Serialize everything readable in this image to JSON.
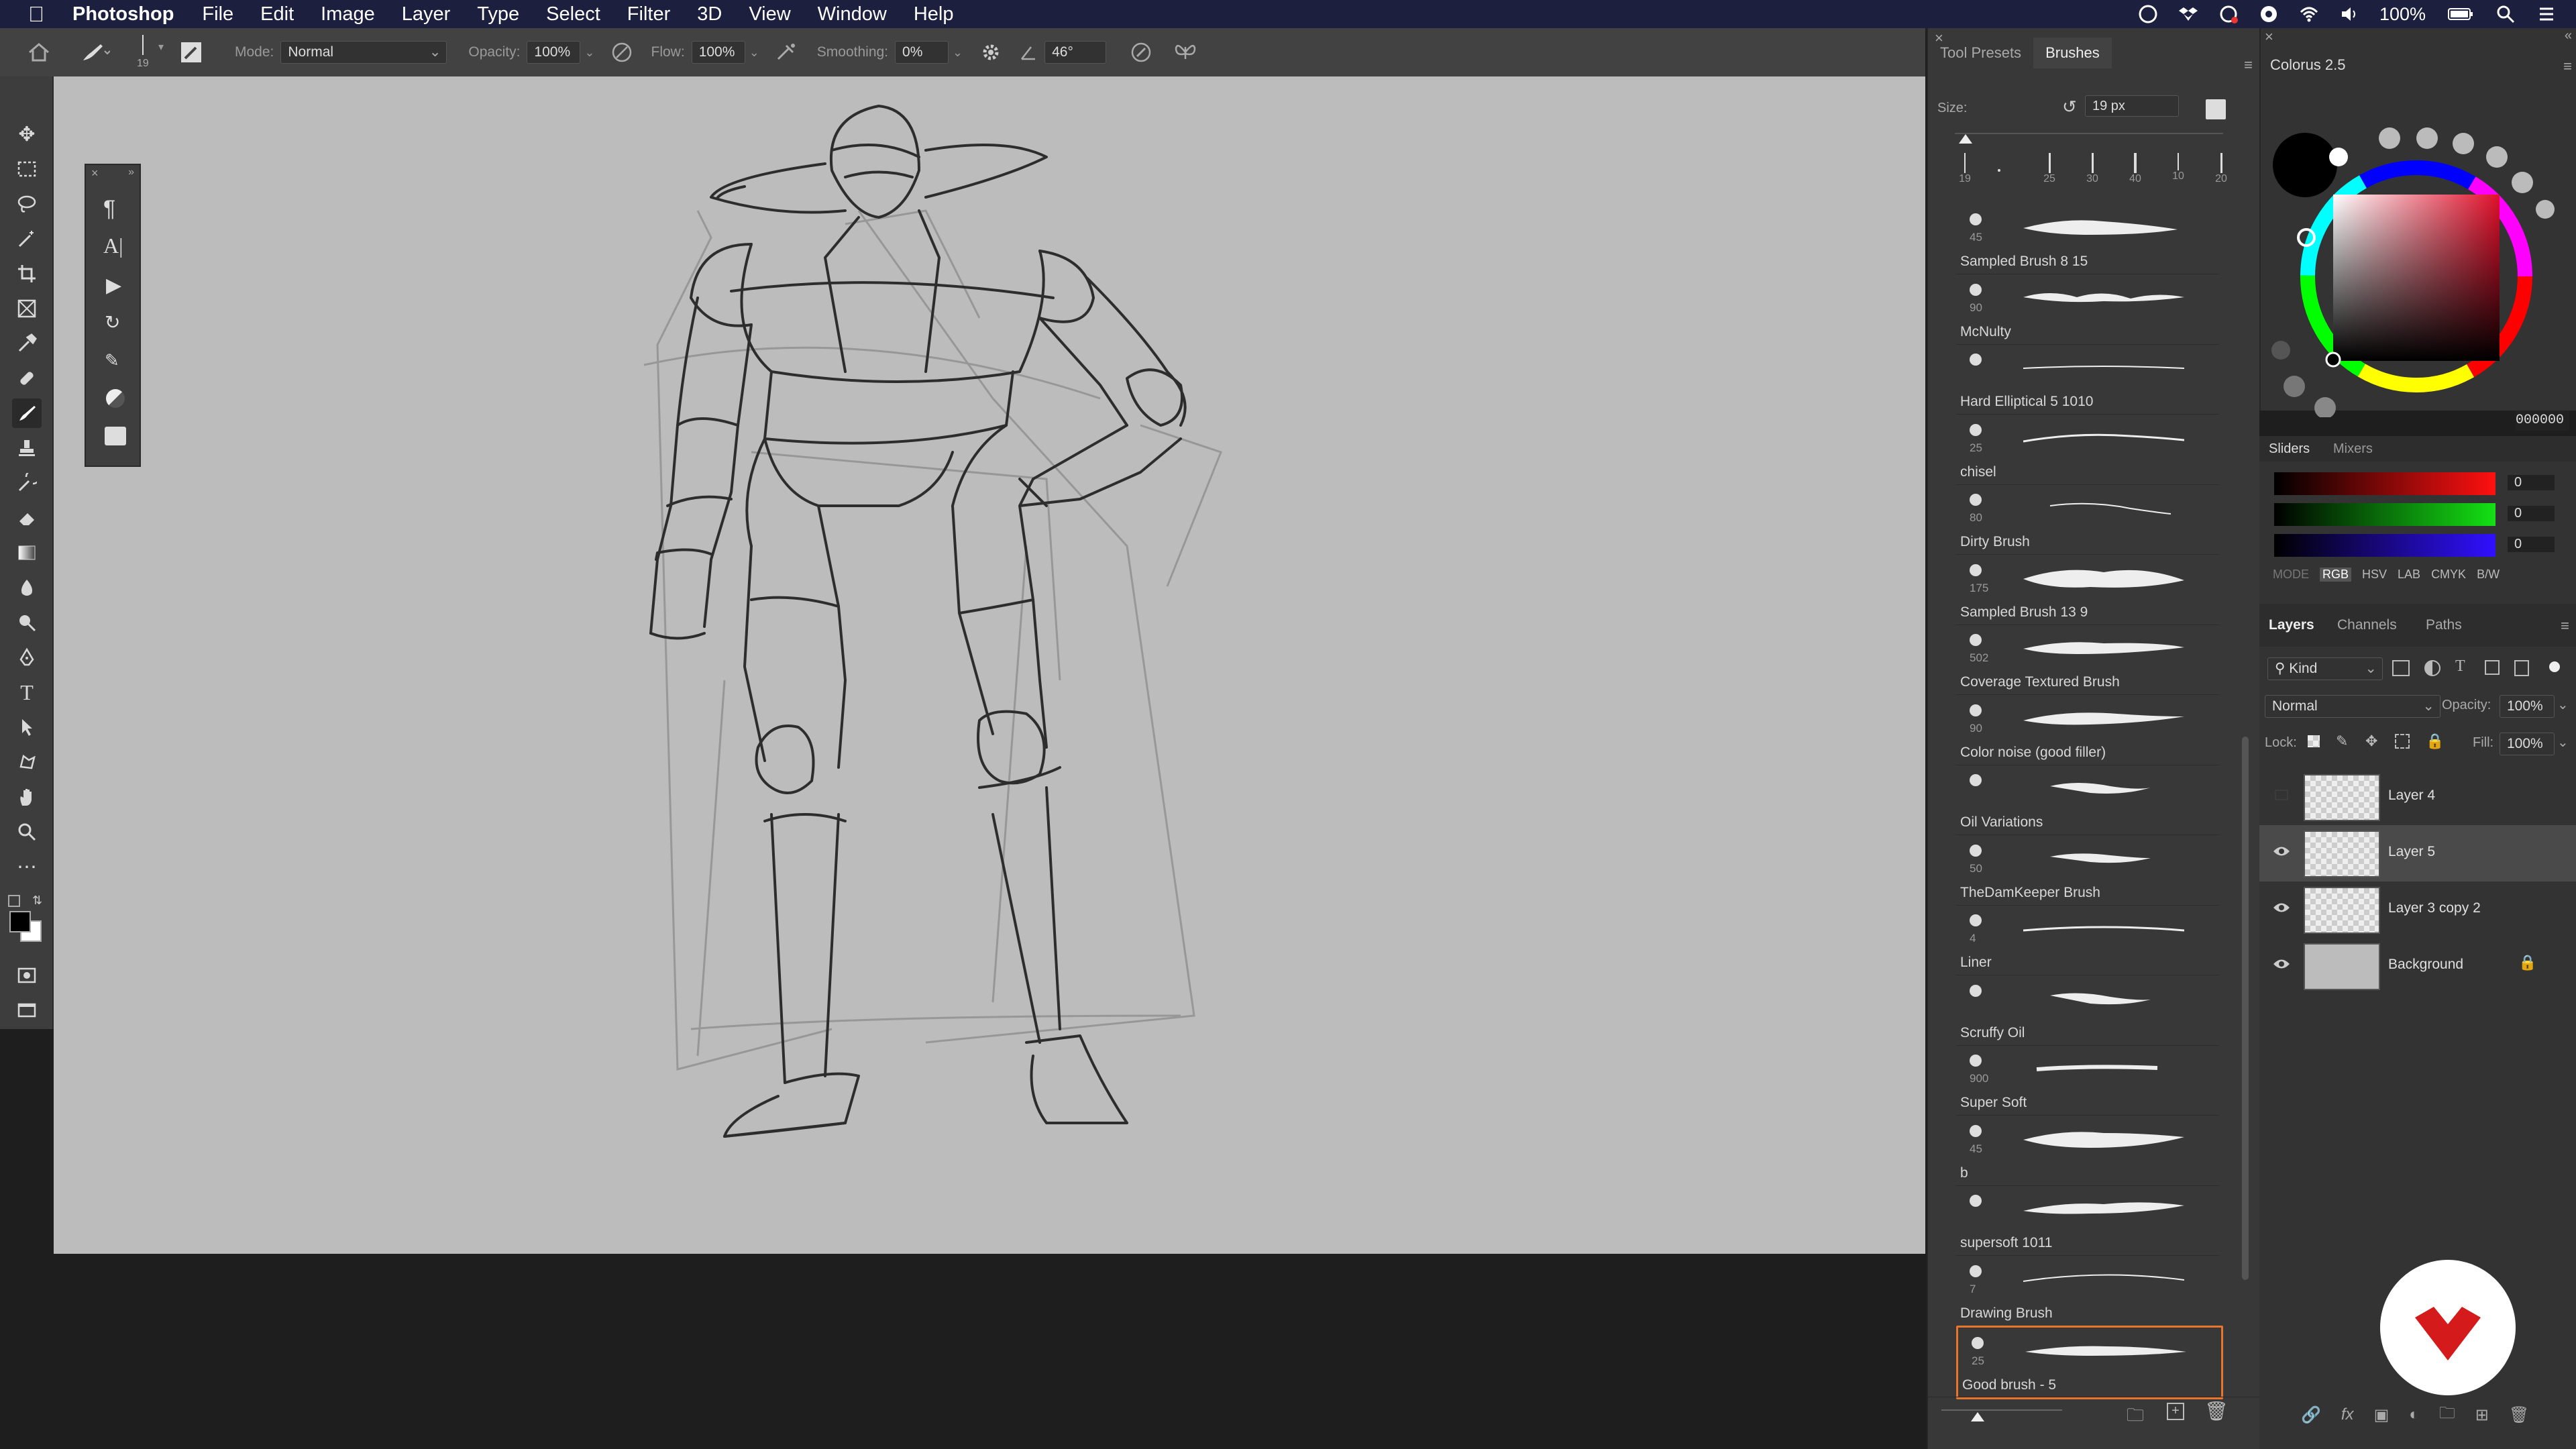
{
  "menubar": {
    "app": "Photoshop",
    "items": [
      "File",
      "Edit",
      "Image",
      "Layer",
      "Type",
      "Select",
      "Filter",
      "3D",
      "View",
      "Window",
      "Help"
    ],
    "battery": "100%"
  },
  "options": {
    "size_value": "19",
    "mode_label": "Mode:",
    "mode_value": "Normal",
    "opacity_label": "Opacity:",
    "opacity_value": "100%",
    "flow_label": "Flow:",
    "flow_value": "100%",
    "smoothing_label": "Smoothing:",
    "smoothing_value": "0%",
    "angle_value": "46°"
  },
  "brushes": {
    "tabs": [
      "Tool Presets",
      "Brushes"
    ],
    "size_label": "Size:",
    "size_value": "19 px",
    "presets": [
      "19",
      "25",
      "30",
      "40",
      "10",
      "20"
    ],
    "items": [
      {
        "name": "Sampled Brush 8 15",
        "size": "45"
      },
      {
        "name": "McNulty",
        "size": "90"
      },
      {
        "name": "Hard Elliptical 5 1010",
        "size": ""
      },
      {
        "name": "chisel",
        "size": "25"
      },
      {
        "name": "Dirty Brush",
        "size": "80"
      },
      {
        "name": "Sampled Brush 13 9",
        "size": "175"
      },
      {
        "name": "Coverage Textured Brush",
        "size": "502"
      },
      {
        "name": "Color noise (good filler)",
        "size": "90"
      },
      {
        "name": "Oil Variations",
        "size": ""
      },
      {
        "name": "TheDamKeeper Brush",
        "size": "50"
      },
      {
        "name": "Liner",
        "size": "4"
      },
      {
        "name": "Scruffy Oil",
        "size": ""
      },
      {
        "name": "Super Soft",
        "size": "900"
      },
      {
        "name": "b",
        "size": "45"
      },
      {
        "name": "supersoft 1011",
        "size": ""
      },
      {
        "name": "Drawing Brush",
        "size": "7"
      },
      {
        "name": "Good brush - 5",
        "size": "25"
      }
    ]
  },
  "color": {
    "title": "Colorus 2.5",
    "hex": "000000",
    "accent": "#e8752d"
  },
  "sliders": {
    "tabs": [
      "Sliders",
      "Mixers"
    ],
    "r": "0",
    "g": "0",
    "b": "0",
    "mode_label": "MODE",
    "modes": [
      "RGB",
      "HSV",
      "LAB",
      "CMYK",
      "B/W"
    ]
  },
  "layers": {
    "tabs": [
      "Layers",
      "Channels",
      "Paths"
    ],
    "kind": "Kind",
    "blend": "Normal",
    "opacity_label": "Opacity:",
    "opacity_value": "100%",
    "lock_label": "Lock:",
    "fill_label": "Fill:",
    "fill_value": "100%",
    "items": [
      {
        "name": "Layer 4",
        "visible": false
      },
      {
        "name": "Layer 5",
        "visible": true
      },
      {
        "name": "Layer 3 copy 2",
        "visible": true
      },
      {
        "name": "Background",
        "visible": true
      }
    ]
  }
}
